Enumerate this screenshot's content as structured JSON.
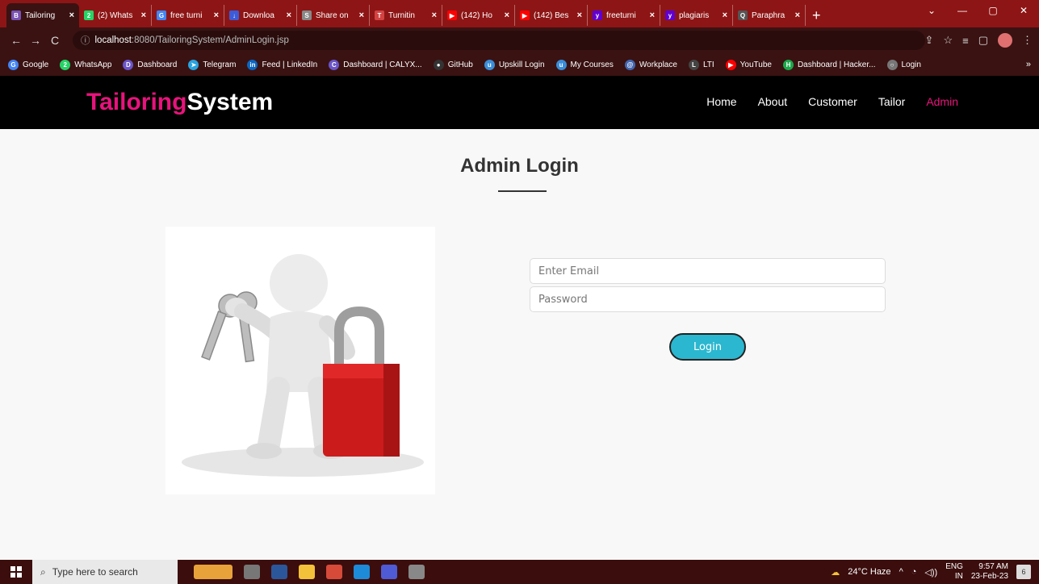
{
  "browser": {
    "tabs": [
      {
        "label": "Tailoring",
        "icon": "bootstrap-icon",
        "color": "#7952b3",
        "glyph": "B"
      },
      {
        "label": "(2) Whats",
        "icon": "whatsapp-icon",
        "color": "#25d366",
        "glyph": "2"
      },
      {
        "label": "free turni",
        "icon": "google-icon",
        "color": "#4285f4",
        "glyph": "G"
      },
      {
        "label": "Downloa",
        "icon": "download-icon",
        "color": "#3c5bd8",
        "glyph": "↓"
      },
      {
        "label": "Share on",
        "icon": "share-icon",
        "color": "#888888",
        "glyph": "S"
      },
      {
        "label": "Turnitin",
        "icon": "turnitin-icon",
        "color": "#d24343",
        "glyph": "T"
      },
      {
        "label": "(142) Ho",
        "icon": "youtube-icon",
        "color": "#ff0000",
        "glyph": "▶"
      },
      {
        "label": "(142) Bes",
        "icon": "youtube-icon",
        "color": "#ff0000",
        "glyph": "▶"
      },
      {
        "label": "freeturni",
        "icon": "yahoo-icon",
        "color": "#6001d2",
        "glyph": "y"
      },
      {
        "label": "plagiaris",
        "icon": "yahoo-icon",
        "color": "#6001d2",
        "glyph": "y"
      },
      {
        "label": "Paraphra",
        "icon": "paraphrase-icon",
        "color": "#555555",
        "glyph": "Q"
      }
    ],
    "new_tab": "+",
    "url_host": "localhost",
    "url_rest": ":8080/TailoringSystem/AdminLogin.jsp",
    "bookmarks": [
      {
        "label": "Google",
        "icon": "google-icon",
        "color": "#4285f4",
        "glyph": "G"
      },
      {
        "label": "WhatsApp",
        "icon": "whatsapp-icon",
        "color": "#25d366",
        "glyph": "2"
      },
      {
        "label": "Dashboard",
        "icon": "dashboard-icon",
        "color": "#6a55c8",
        "glyph": "D"
      },
      {
        "label": "Telegram",
        "icon": "telegram-icon",
        "color": "#2aa3e0",
        "glyph": "➤"
      },
      {
        "label": "Feed | LinkedIn",
        "icon": "linkedin-icon",
        "color": "#0a66c2",
        "glyph": "in"
      },
      {
        "label": "Dashboard | CALYX...",
        "icon": "calyx-icon",
        "color": "#6a55c8",
        "glyph": "C"
      },
      {
        "label": "GitHub",
        "icon": "github-icon",
        "color": "#333333",
        "glyph": "●"
      },
      {
        "label": "Upskill Login",
        "icon": "upskill-icon",
        "color": "#3a8dd8",
        "glyph": "u"
      },
      {
        "label": "My Courses",
        "icon": "courses-icon",
        "color": "#3a8dd8",
        "glyph": "u"
      },
      {
        "label": "Workplace",
        "icon": "workplace-icon",
        "color": "#4267b2",
        "glyph": "@"
      },
      {
        "label": "LTI",
        "icon": "lti-icon",
        "color": "#444444",
        "glyph": "L"
      },
      {
        "label": "YouTube",
        "icon": "youtube-icon",
        "color": "#ff0000",
        "glyph": "▶"
      },
      {
        "label": "Dashboard | Hacker...",
        "icon": "hackerrank-icon",
        "color": "#1ba94c",
        "glyph": "H"
      },
      {
        "label": "Login",
        "icon": "login-icon",
        "color": "#777777",
        "glyph": "○"
      }
    ],
    "bookmarks_more": "»"
  },
  "site": {
    "brand_part1": "Tailoring",
    "brand_part2": "System",
    "nav": {
      "home": "Home",
      "about": "About",
      "customer": "Customer",
      "tailor": "Tailor",
      "admin": "Admin"
    },
    "brand_accent": "#e8137c"
  },
  "login": {
    "title": "Admin Login",
    "email_placeholder": "Enter Email",
    "password_placeholder": "Password",
    "button_label": "Login",
    "button_color": "#2bb7cf"
  },
  "taskbar": {
    "search_placeholder": "Type here to search",
    "weather": "24°C  Haze",
    "lang": "ENG",
    "region": "IN",
    "time": "9:57 AM",
    "date": "23-Feb-23",
    "notifications": "6"
  }
}
